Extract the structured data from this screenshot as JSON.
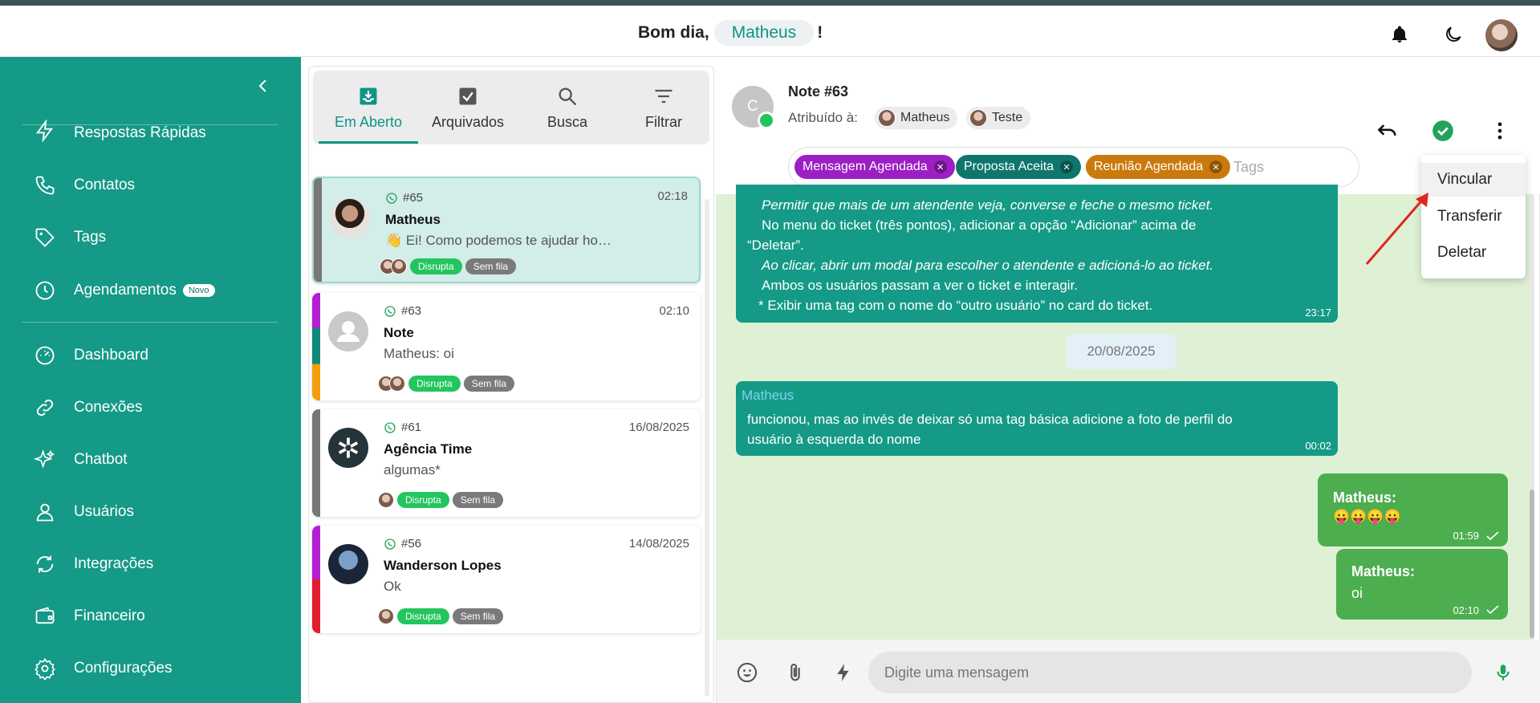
{
  "header": {
    "greeting": "Bom dia,",
    "user_name": "Matheus",
    "exclaim": "!"
  },
  "sidebar": {
    "items": [
      {
        "label": "Respostas Rápidas"
      },
      {
        "label": "Contatos"
      },
      {
        "label": "Tags"
      },
      {
        "label": "Agendamentos",
        "badge": "Novo"
      },
      {
        "label": "Dashboard"
      },
      {
        "label": "Conexões"
      },
      {
        "label": "Chatbot"
      },
      {
        "label": "Usuários"
      },
      {
        "label": "Integrações"
      },
      {
        "label": "Financeiro"
      },
      {
        "label": "Configurações"
      }
    ]
  },
  "tabs": [
    {
      "label": "Em Aberto"
    },
    {
      "label": "Arquivados"
    },
    {
      "label": "Busca"
    },
    {
      "label": "Filtrar"
    }
  ],
  "tickets": [
    {
      "num": "#65",
      "time": "02:18",
      "name": "Matheus",
      "msg": "👋 Ei! Como podemos te ajudar ho…",
      "tags": [
        "Disrupta",
        "Sem fila"
      ]
    },
    {
      "num": "#63",
      "time": "02:10",
      "name": "Note",
      "msg_prefix": "Matheus:",
      "msg": "oi",
      "tags": [
        "Disrupta",
        "Sem fila"
      ]
    },
    {
      "num": "#61",
      "time": "16/08/2025",
      "name": "Agência Time",
      "msg": "algumas*",
      "tags": [
        "Disrupta",
        "Sem fila"
      ]
    },
    {
      "num": "#56",
      "time": "14/08/2025",
      "name": "Wanderson Lopes",
      "msg": "Ok",
      "tags": [
        "Disrupta",
        "Sem fila"
      ]
    }
  ],
  "chat": {
    "avatar_letter": "C",
    "title": "Note #63",
    "assigned_label": "Atribuído à:",
    "assignees": [
      "Matheus",
      "Teste"
    ],
    "tags": [
      {
        "label": "Mensagem Agendada",
        "color": "#9c1fc4"
      },
      {
        "label": "Proposta Aceita",
        "color": "#0f766e"
      },
      {
        "label": "Reunião Agendada",
        "color": "#ca7a0c"
      }
    ],
    "tags_placeholder": "Tags",
    "messages": {
      "m1_lines": [
        "Permitir que mais de um atendente veja, converse e feche o mesmo ticket.",
        "No menu do ticket (três pontos), adicionar a opção “Adicionar” acima de",
        "“Deletar”.",
        "Ao clicar, abrir um modal para escolher o atendente e adicioná-lo ao ticket.",
        "Ambos os usuários passam a ver o ticket e interagir.",
        "* Exibir uma tag com o nome do “outro usuário” no card do ticket."
      ],
      "m1_time": "23:17",
      "date_divider": "20/08/2025",
      "m2_sender": "Matheus",
      "m2_lines": [
        "funcionou, mas ao invés de deixar só uma tag básica adicione a foto de perfil do",
        "usuário à esquerda do nome"
      ],
      "m2_time": "00:02",
      "m3_sender": "Matheus:",
      "m3_text": "😛😛😛😛",
      "m3_time": "01:59",
      "m4_sender": "Matheus:",
      "m4_text": "oi",
      "m4_time": "02:10"
    },
    "input_placeholder": "Digite uma mensagem"
  },
  "context_menu": {
    "items": [
      "Vincular",
      "Transferir",
      "Deletar"
    ]
  },
  "colors": {
    "brand": "#149a86",
    "chat_bg": "#dff1d4",
    "outgoing": "#4cae4f",
    "annotation_arrow": "#e02424"
  }
}
